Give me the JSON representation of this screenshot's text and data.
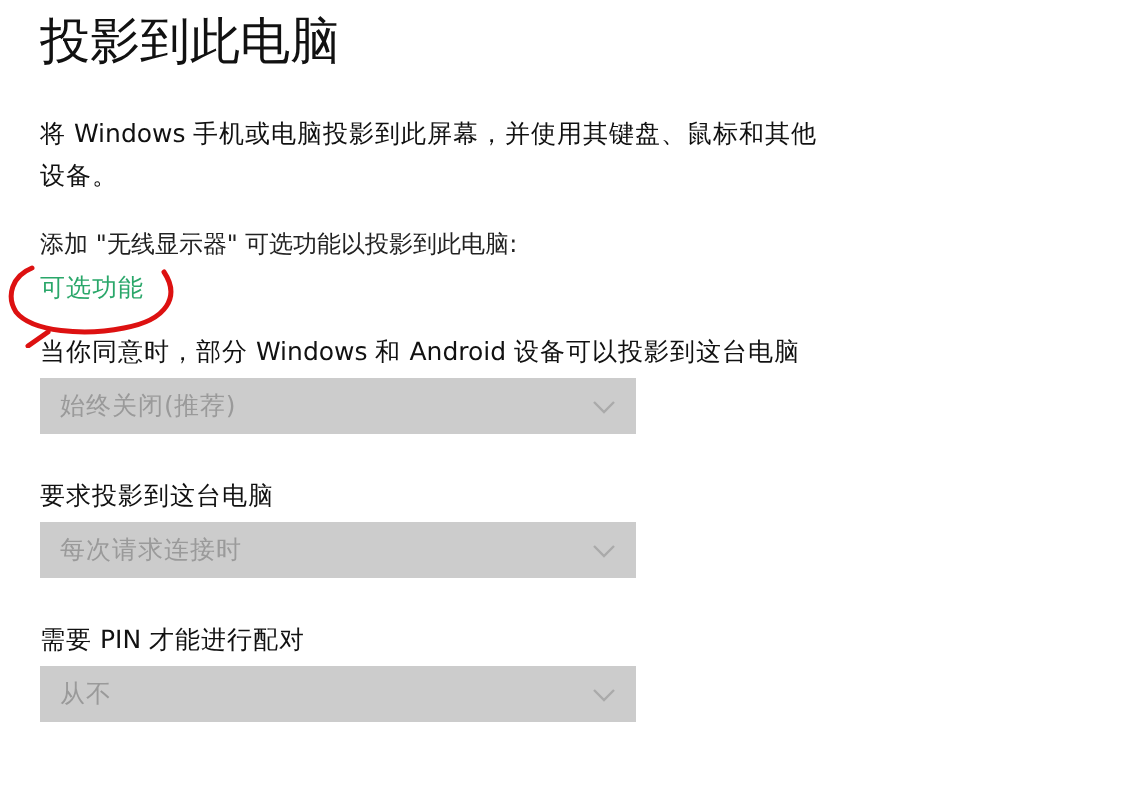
{
  "title": "投影到此电脑",
  "description": "将 Windows 手机或电脑投影到此屏幕，并使用其键盘、鼠标和其他设备。",
  "optional_feature": {
    "text": "添加 \"无线显示器\" 可选功能以投影到此电脑:",
    "link": "可选功能",
    "annotated": true
  },
  "settings": [
    {
      "label": "当你同意时，部分 Windows 和 Android 设备可以投影到这台电脑",
      "value": "始终关闭(推荐)",
      "disabled": true
    },
    {
      "label": "要求投影到这台电脑",
      "value": "每次请求连接时",
      "disabled": true
    },
    {
      "label": "需要 PIN 才能进行配对",
      "value": "从不",
      "disabled": true
    }
  ]
}
